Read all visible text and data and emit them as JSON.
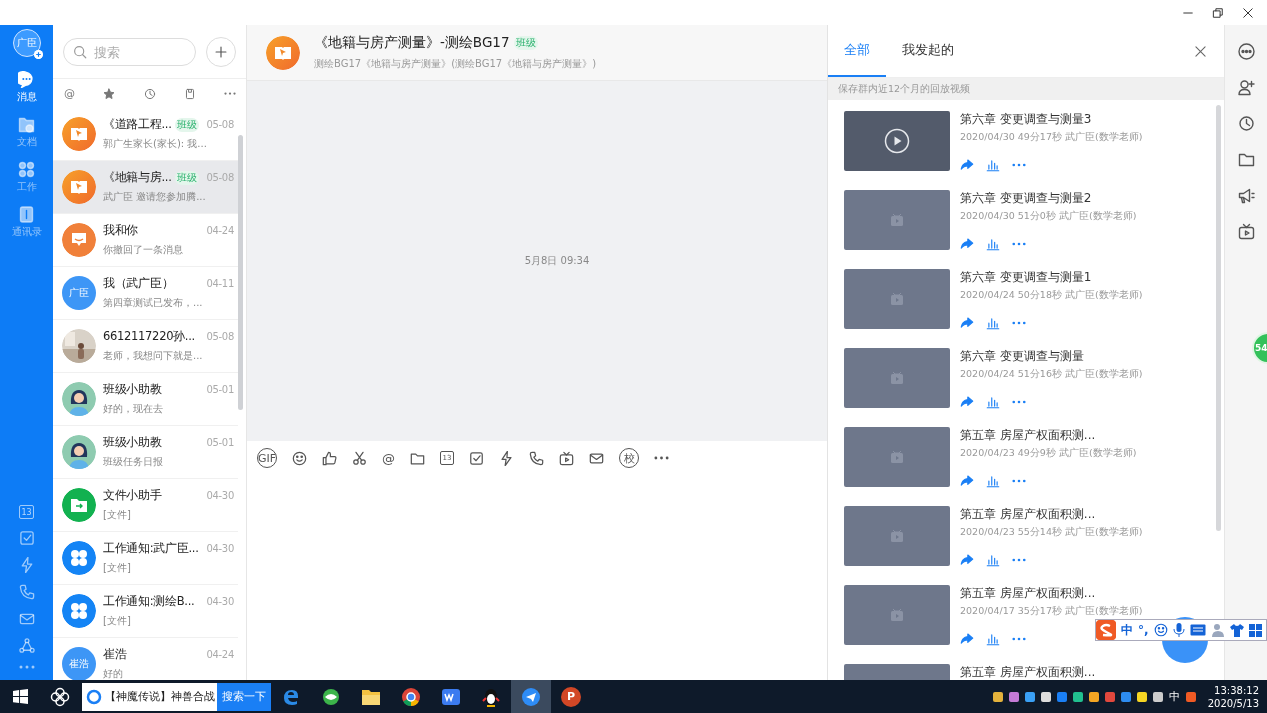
{
  "nav": {
    "avatar": "广臣",
    "items": [
      {
        "kind": "chat",
        "label": "消息",
        "selected": true
      },
      {
        "kind": "docs",
        "label": "文档",
        "selected": false
      },
      {
        "kind": "apps",
        "label": "工作",
        "selected": false
      },
      {
        "kind": "contacts",
        "label": "通讯录",
        "selected": false
      }
    ],
    "tools": [
      {
        "kind": "calendar",
        "label": "13"
      },
      {
        "kind": "check"
      },
      {
        "kind": "bolt"
      },
      {
        "kind": "phone"
      },
      {
        "kind": "mail"
      },
      {
        "kind": "share"
      },
      {
        "kind": "more"
      }
    ]
  },
  "chat_list": {
    "search": {
      "placeholder": "搜索"
    },
    "filters": [
      {
        "kind": "char",
        "label": "@"
      },
      {
        "kind": "star"
      },
      {
        "kind": "clock"
      },
      {
        "kind": "clipboard"
      },
      {
        "kind": "more"
      }
    ],
    "chats": [
      {
        "avatar": {
          "kind": "book"
        },
        "name": "《道路工程...",
        "badge": "班级",
        "time": "05-08",
        "preview": "郭广生家长(家长): 我...",
        "selected": false
      },
      {
        "avatar": {
          "kind": "book"
        },
        "name": "《地籍与房...",
        "badge": "班级",
        "time": "05-08",
        "preview": "武广臣 邀请您参加腾...",
        "selected": true
      },
      {
        "avatar": {
          "kind": "hi"
        },
        "name": "我和你",
        "time": "04-24",
        "preview": "你撤回了一条消息",
        "selected": false
      },
      {
        "avatar": {
          "kind": "text",
          "text": "广臣"
        },
        "name": "我（武广臣）",
        "time": "04-11",
        "preview": "第四章测试已发布，...",
        "selected": false
      },
      {
        "name": "6612117220孙...",
        "time": "05-08",
        "preview": "老师，我想问下就是...",
        "selected": false
      },
      {
        "avatar": {
          "kind": "person"
        },
        "name": "班级小助教",
        "time": "05-01",
        "preview": "好的，现在去",
        "selected": false
      },
      {
        "avatar": {
          "kind": "person"
        },
        "name": "班级小助教",
        "time": "05-01",
        "preview": "班级任务日报",
        "selected": false
      },
      {
        "avatar": {
          "kind": "folder"
        },
        "name": "文件小助手",
        "time": "04-30",
        "preview": "[文件]",
        "selected": false
      },
      {
        "avatar": {
          "kind": "clover"
        },
        "name": "工作通知:武广臣...",
        "time": "04-30",
        "preview": "[文件]",
        "selected": false
      },
      {
        "avatar": {
          "kind": "clover"
        },
        "name": "工作通知:测绘B...",
        "time": "04-30",
        "preview": "[文件]",
        "selected": false
      },
      {
        "avatar": {
          "kind": "text",
          "text": "崔浩"
        },
        "name": "崔浩",
        "time": "04-24",
        "preview": "好的",
        "selected": false
      }
    ]
  },
  "conversation": {
    "title": "《地籍与房产测量》-测绘BG17",
    "badge": "班级",
    "subtitle": "测绘BG17《地籍与房产测量》(测绘BG17《地籍与房产测量》)",
    "timestamp": "5月8日 09:34",
    "toolbar": [
      {
        "kind": "label",
        "label": "GIF"
      },
      {
        "kind": "emoji"
      },
      {
        "kind": "thumb"
      },
      {
        "kind": "scissors"
      },
      {
        "kind": "char",
        "label": "@"
      },
      {
        "kind": "folder"
      },
      {
        "kind": "calendar",
        "label": "13"
      },
      {
        "kind": "check"
      },
      {
        "kind": "bolt"
      },
      {
        "kind": "phone"
      },
      {
        "kind": "tv"
      },
      {
        "kind": "mail"
      },
      {
        "kind": "label",
        "label": "校"
      },
      {
        "kind": "more"
      }
    ]
  },
  "panel": {
    "tabs": [
      {
        "label": "全部",
        "selected": true
      },
      {
        "label": "我发起的",
        "selected": false
      }
    ],
    "notice": "保存群内近12个月的回放视频",
    "videos": [
      {
        "kind": "play",
        "title": "第六章 变更调查与测量3",
        "meta": "2020/04/30 49分17秒 武广臣(数学老师)"
      },
      {
        "kind": "tv",
        "title": "第六章 变更调查与测量2",
        "meta": "2020/04/30 51分0秒 武广臣(数学老师)"
      },
      {
        "kind": "tv",
        "title": "第六章 变更调查与测量1",
        "meta": "2020/04/24 50分18秒 武广臣(数学老师)"
      },
      {
        "kind": "tv",
        "title": "第六章 变更调查与测量",
        "meta": "2020/04/24 51分16秒 武广臣(数学老师)"
      },
      {
        "kind": "tv",
        "title": "第五章 房屋产权面积测...",
        "meta": "2020/04/23 49分9秒 武广臣(数学老师)"
      },
      {
        "kind": "tv",
        "title": "第五章 房屋产权面积测...",
        "meta": "2020/04/23 55分14秒 武广臣(数学老师)"
      },
      {
        "kind": "tv",
        "title": "第五章 房屋产权面积测...",
        "meta": "2020/04/17 35分17秒 武广臣(数学老师)"
      },
      {
        "kind": "plain",
        "title": "第五章 房屋产权面积测..."
      }
    ]
  },
  "rail": [
    {
      "kind": "dots"
    },
    {
      "kind": "adduser"
    },
    {
      "kind": "clock"
    },
    {
      "kind": "folder"
    },
    {
      "kind": "megaphone"
    },
    {
      "kind": "tv"
    }
  ],
  "float_badge": "54",
  "ime": {
    "mode": "中",
    "punct": "°,"
  },
  "taskbar": {
    "search": {
      "value": "【神魔传说】神兽合战",
      "button": "搜索一下"
    },
    "apps": [
      {
        "kind": "edge",
        "selected": false
      },
      {
        "kind": "browser360",
        "selected": false
      },
      {
        "kind": "explorer",
        "selected": false
      },
      {
        "kind": "chrome",
        "selected": false
      },
      {
        "kind": "wps",
        "selected": false
      },
      {
        "kind": "penguin",
        "selected": false
      },
      {
        "kind": "messenger",
        "selected": true
      },
      {
        "kind": "ppt",
        "label": "P",
        "selected": false
      }
    ],
    "tray_lang": "中",
    "time": "13:38:12",
    "date": "2020/5/13"
  }
}
